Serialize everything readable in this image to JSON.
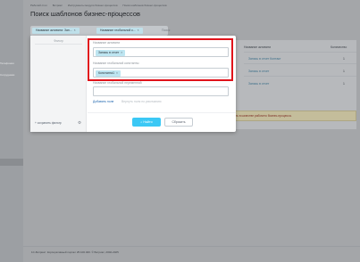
{
  "breadcrumbs": [
    "Рабочий стол",
    "Битрикс",
    "Инструменты модуля бизнес-процессов",
    "Поиск шаблонов бизнес-процессов"
  ],
  "page_title": "Поиск шаблонов бизнес-процессов",
  "search_bar": {
    "chips": [
      "Название активити: Зап...",
      "Название глобальной к..."
    ],
    "placeholder": "Поиск"
  },
  "table": {
    "col_activity": "Название активити",
    "col_count": "Количество",
    "rows": [
      {
        "activity": "Запись в отчет Контакт",
        "count": "1"
      },
      {
        "activity": "Запись в отчет",
        "count": "1"
      },
      {
        "activity": "Запись в отчет",
        "count": "1"
      }
    ]
  },
  "notice": "...ть в качестве рабочего бизнес-процесса.",
  "footer": "1С-Битрикс: Корпоративный портал 25.100.400. © Битрикс, 2002-2025",
  "filter_popup": {
    "presets_title": "Фильтр",
    "save_filter": "+ сохранить фильтр",
    "fields": [
      {
        "label": "Название активити",
        "chip": "Запись в отчет"
      },
      {
        "label": "Название глобальной константы",
        "chip": "Константа1"
      },
      {
        "label": "Название глобальной переменной",
        "chip": ""
      }
    ],
    "add_field": "Добавить поле",
    "restore_fields": "Вернуть поля по умолчанию",
    "find_button": "Найти",
    "reset_button": "Сбросить"
  },
  "sidebar": {
    "items": [
      "Телефония",
      "Сотрудники"
    ]
  }
}
